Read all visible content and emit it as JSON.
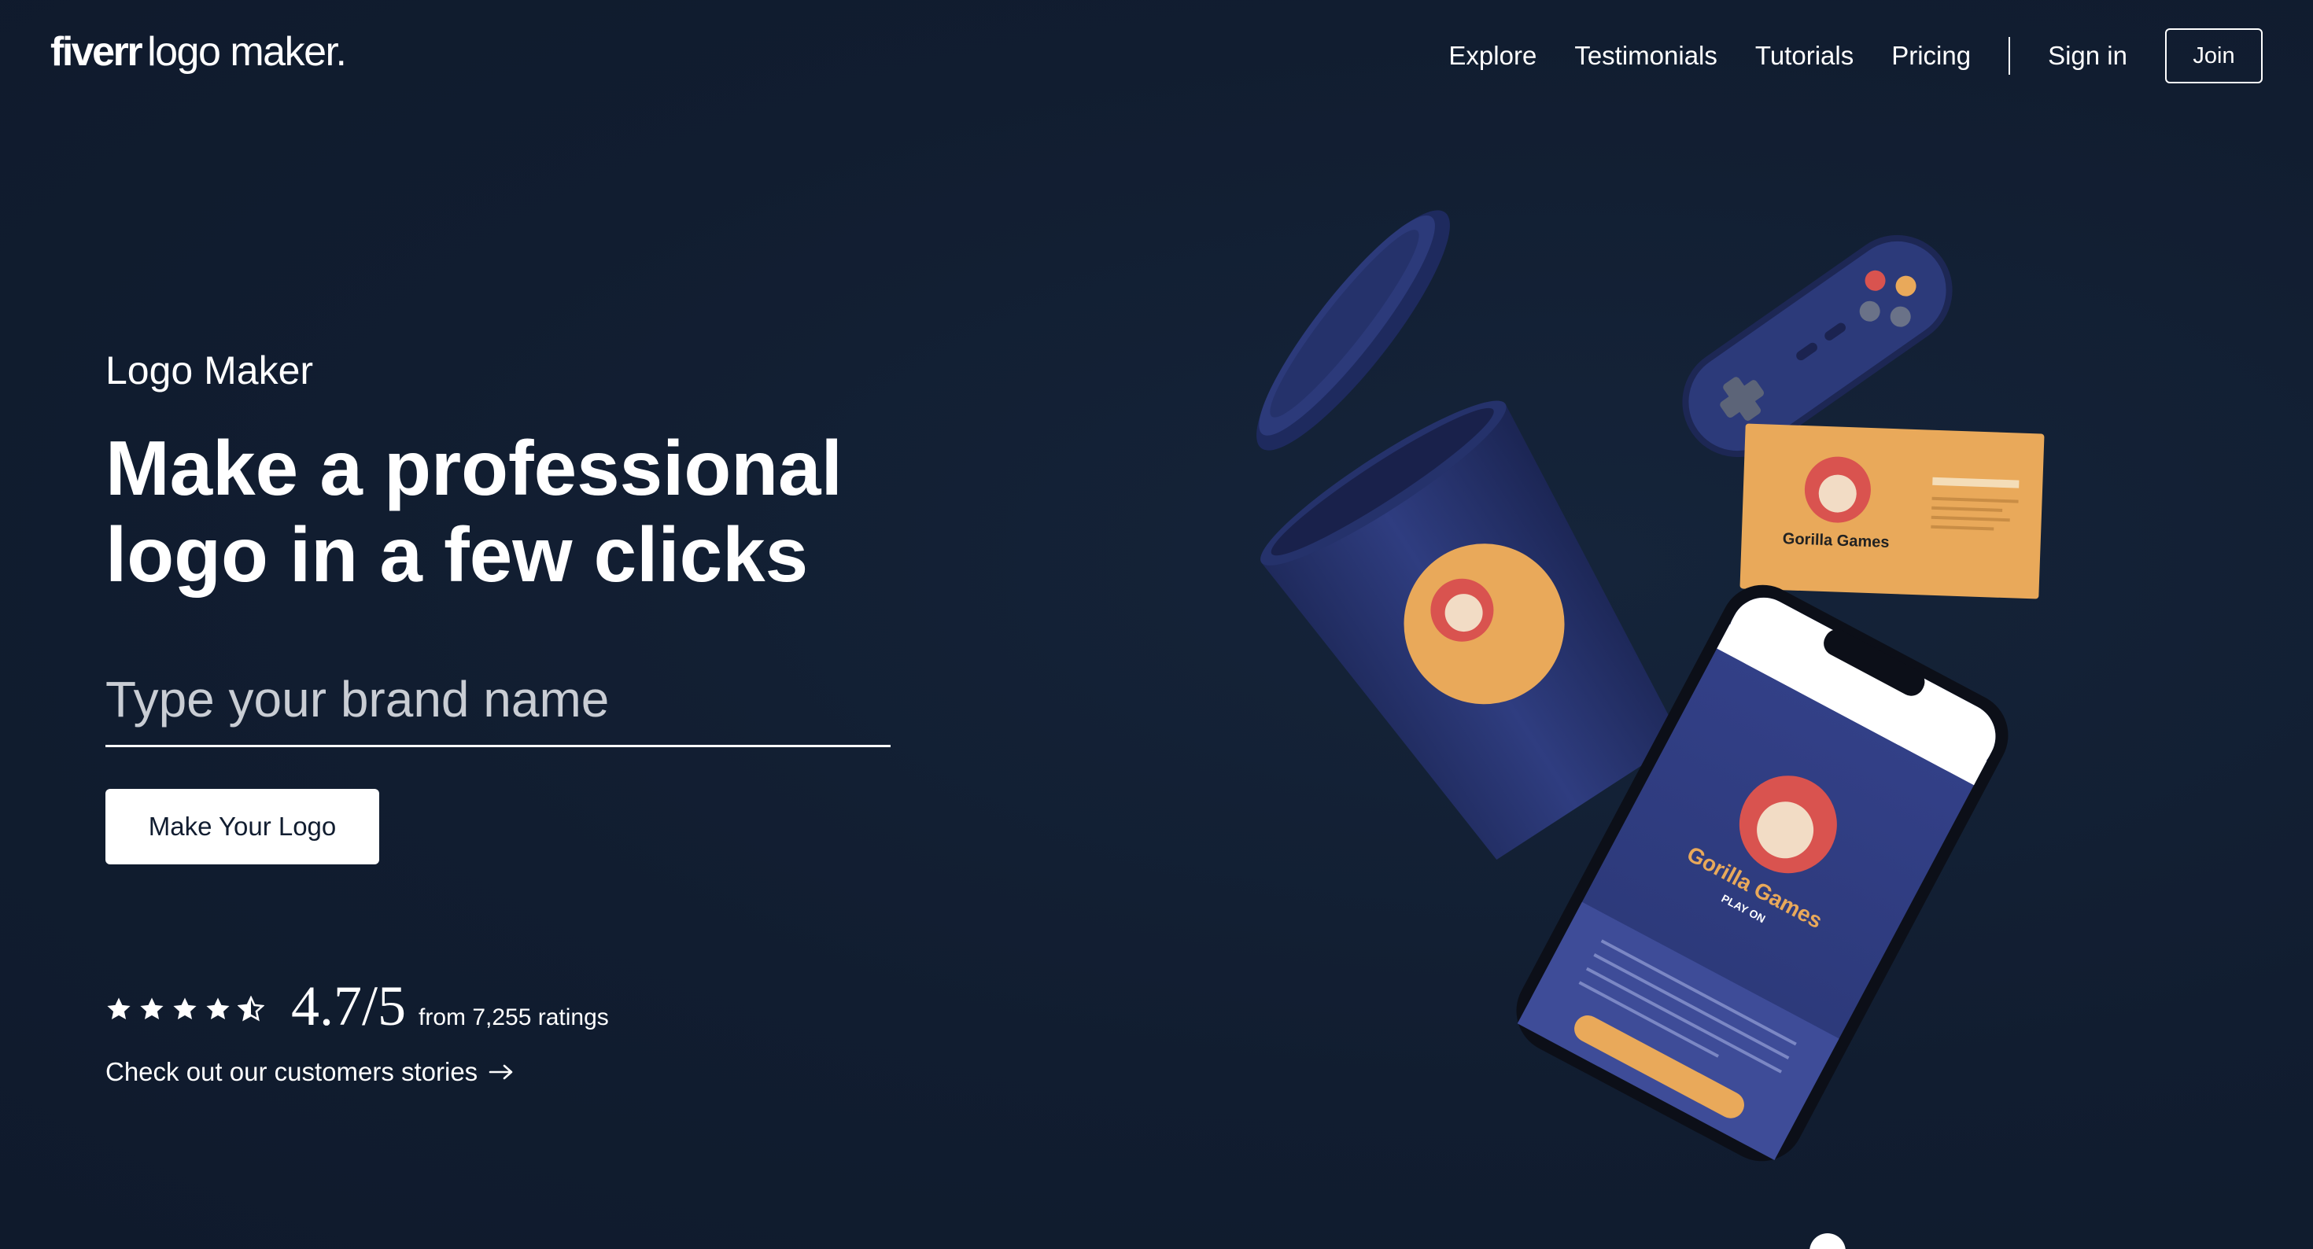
{
  "header": {
    "logo_brand": "fiverr",
    "logo_rest": "logo maker.",
    "nav": [
      "Explore",
      "Testimonials",
      "Tutorials",
      "Pricing"
    ],
    "sign_in": "Sign in",
    "join": "Join"
  },
  "hero": {
    "eyebrow": "Logo Maker",
    "headline": "Make a professional logo in a few clicks",
    "input_placeholder": "Type your brand name",
    "cta": "Make Your Logo",
    "rating": {
      "stars": 4.5,
      "score": "4.7/5",
      "count_text": "from 7,255 ratings"
    },
    "stories_link": "Check out our customers stories"
  },
  "mockups": {
    "brand_name": "Gorilla Games",
    "tagline": "PLAY ON"
  },
  "colors": {
    "background": "#111d30",
    "navy": "#2c3a7a",
    "orange": "#e9a95a",
    "text": "#ffffff"
  }
}
